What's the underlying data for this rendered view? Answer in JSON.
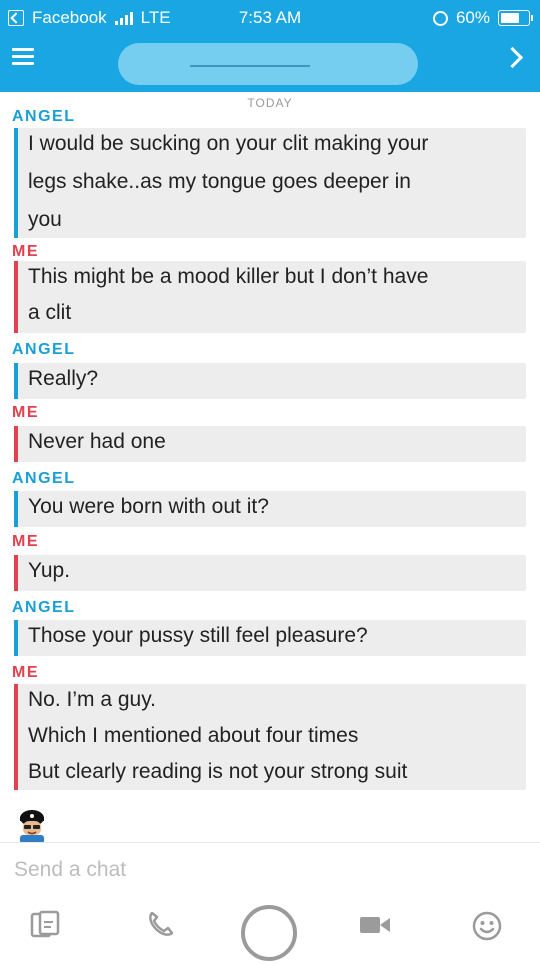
{
  "status_bar": {
    "back_app": "Facebook",
    "network": "LTE",
    "time": "7:53 AM",
    "battery": "60%"
  },
  "chat": {
    "date_divider": "TODAY",
    "messages": [
      {
        "sender": "ANGEL",
        "lines": [
          "I would be sucking on your clit making your",
          "legs shake..as my tongue goes deeper in",
          "you"
        ]
      },
      {
        "sender": "ME",
        "lines": [
          "This might be a mood killer but I don’t have",
          "a clit"
        ]
      },
      {
        "sender": "ANGEL",
        "lines": [
          "Really?"
        ]
      },
      {
        "sender": "ME",
        "lines": [
          "Never had one"
        ]
      },
      {
        "sender": "ANGEL",
        "lines": [
          "You were born with out it?"
        ]
      },
      {
        "sender": "ME",
        "lines": [
          "Yup."
        ]
      },
      {
        "sender": "ANGEL",
        "lines": [
          "Those your pussy still feel pleasure?"
        ]
      },
      {
        "sender": "ME",
        "lines": [
          "No. I’m a guy.",
          "Which I mentioned about four times",
          "But clearly reading is not your strong suit"
        ]
      }
    ]
  },
  "input": {
    "placeholder": "Send a chat"
  },
  "icons": {
    "menu": "hamburger-icon",
    "next": "chevron-right-icon",
    "chat": "chat-cards-icon",
    "call": "phone-icon",
    "capture": "capture-circle-icon",
    "video": "video-camera-icon",
    "emoji": "smiley-icon"
  },
  "colors": {
    "header": "#1aa6e3",
    "angel": "#1a9fd6",
    "me": "#e0424f"
  }
}
